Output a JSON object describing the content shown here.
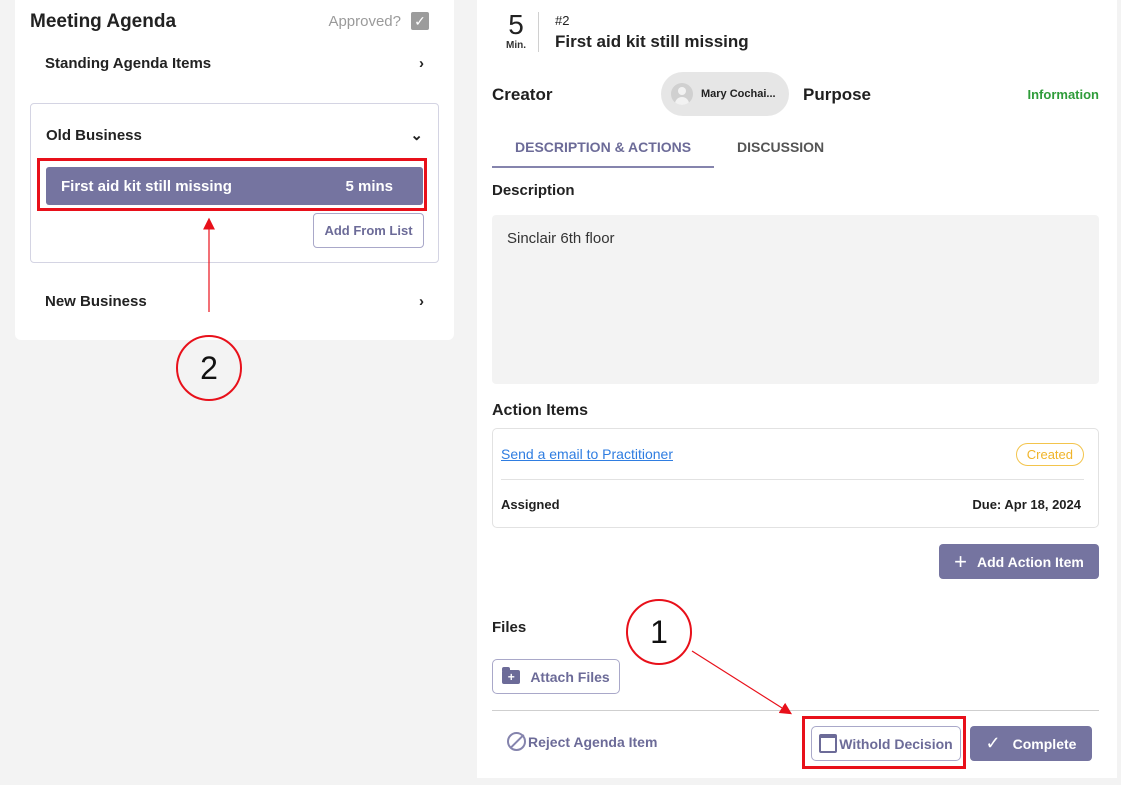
{
  "left": {
    "title": "Meeting Agenda",
    "approved_label": "Approved?",
    "approved_checked": true,
    "sections": [
      {
        "label": "Standing Agenda Items",
        "expanded": false
      },
      {
        "label": "Old Business",
        "expanded": true
      },
      {
        "label": "New Business",
        "expanded": false
      }
    ],
    "old_business_items": [
      {
        "title": "First aid kit still missing",
        "duration": "5 mins"
      }
    ],
    "add_from_list_label": "Add From List"
  },
  "detail": {
    "duration_value": "5",
    "duration_unit": "Min.",
    "item_number": "#2",
    "item_title": "First aid kit still missing",
    "creator_label": "Creator",
    "creator_name": "Mary Cochai...",
    "purpose_label": "Purpose",
    "purpose_value": "Information",
    "purpose_color": "#2f9c3a",
    "tabs": [
      {
        "label": "DESCRIPTION & ACTIONS",
        "active": true
      },
      {
        "label": "DISCUSSION",
        "active": false
      }
    ],
    "description_label": "Description",
    "description_text": "Sinclair 6th floor",
    "action_items_label": "Action Items",
    "action_items": [
      {
        "title": "Send a email to Practitioner",
        "status": "Created",
        "assignee_label": "Assigned",
        "due": "Due: Apr 18, 2024"
      }
    ],
    "add_action_label": "Add Action Item",
    "files_label": "Files",
    "attach_files_label": "Attach Files",
    "reject_label": "Reject Agenda Item",
    "withhold_label": "Withold Decision",
    "complete_label": "Complete"
  },
  "annotations": {
    "callout_1": "1",
    "callout_2": "2",
    "highlight_color": "#e8101a"
  },
  "theme": {
    "accent": "#7574a0",
    "status_created": "#f0b429",
    "link": "#2f7de1"
  }
}
